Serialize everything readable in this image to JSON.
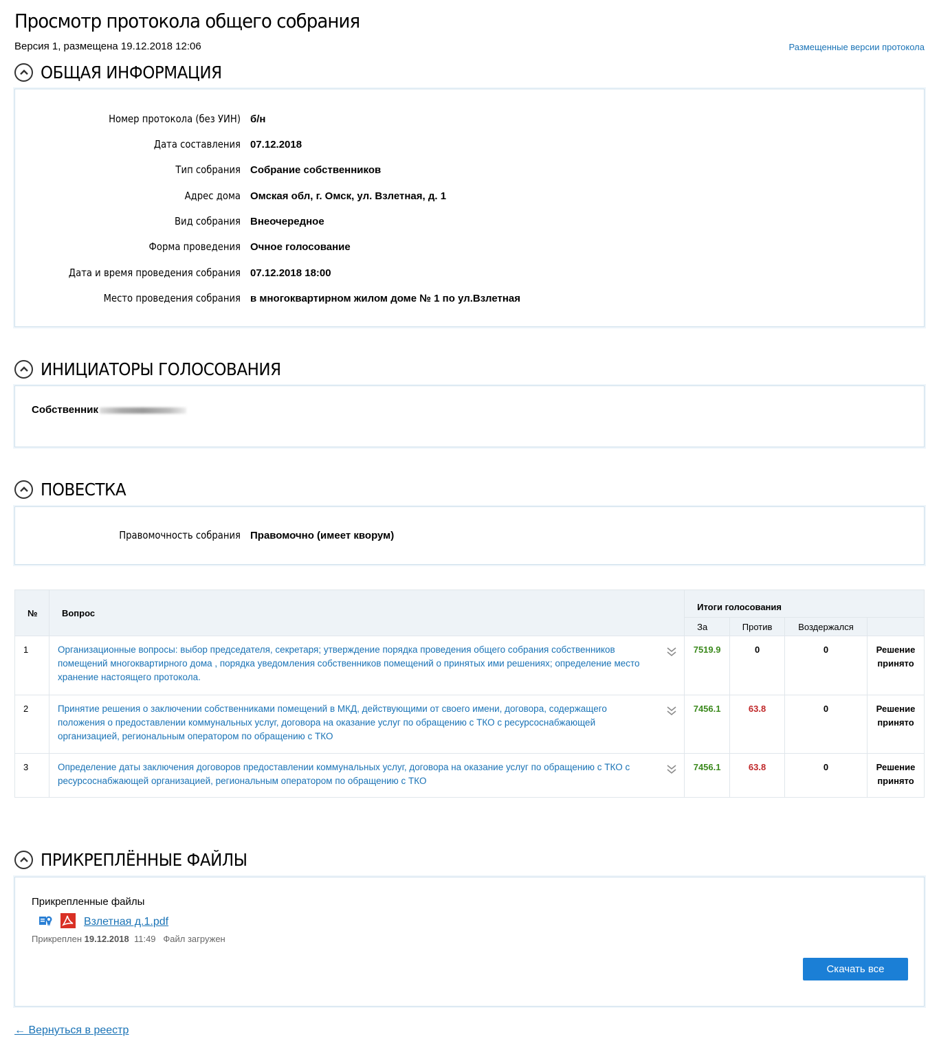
{
  "page": {
    "title": "Просмотр протокола общего собрания",
    "version": "Версия 1, размещена 19.12.2018 12:06",
    "versions_link": "Размещенные версии протокола"
  },
  "general": {
    "title": "ОБЩАЯ ИНФОРМАЦИЯ",
    "fields": [
      {
        "label": "Номер протокола (без УИН)",
        "value": "б/н"
      },
      {
        "label": "Дата составления",
        "value": "07.12.2018"
      },
      {
        "label": "Тип собрания",
        "value": "Собрание собственников"
      },
      {
        "label": "Адрес дома",
        "value": "Омская обл, г. Омск, ул. Взлетная, д. 1"
      },
      {
        "label": "Вид собрания",
        "value": "Внеочередное"
      },
      {
        "label": "Форма проведения",
        "value": "Очное голосование"
      },
      {
        "label": "Дата и время проведения собрания",
        "value": "07.12.2018 18:00"
      },
      {
        "label": "Место проведения собрания",
        "value": "в многоквартирном жилом доме № 1 по ул.Взлетная"
      }
    ]
  },
  "initiators": {
    "title": "ИНИЦИАТОРЫ ГОЛОСОВАНИЯ",
    "item": "Собственник"
  },
  "agenda": {
    "title": "ПОВЕСТКА",
    "quorum_label": "Правомочность собрания",
    "quorum_value": "Правомочно (имеет кворум)"
  },
  "votes": {
    "headers": {
      "num": "№",
      "question": "Вопрос",
      "results": "Итоги голосования",
      "za": "За",
      "protiv": "Против",
      "vozd": "Воздержался"
    },
    "rows": [
      {
        "num": "1",
        "question": "Организационные вопросы: выбор председателя, секретаря; утверждение порядка проведения общего собрания собственников помещений многоквартирного дома , порядка уведомления собственников помещений о принятых ими решениях; определение место хранение настоящего протокола.",
        "za": "7519.9",
        "protiv": "0",
        "vozd": "0",
        "result": "Решение принято"
      },
      {
        "num": "2",
        "question": "Принятие решения о заключении собственниками помещений в МКД, действующими от своего имени, договора, содержащего положения о предоставлении коммунальных услуг, договора на оказание услуг по обращению с ТКО с ресурсоснабжающей организацией, региональным оператором по обращению с ТКО",
        "za": "7456.1",
        "protiv": "63.8",
        "vozd": "0",
        "result": "Решение принято"
      },
      {
        "num": "3",
        "question": "Определение даты заключения договоров  предоставлении коммунальных услуг, договора на оказание услуг по обращению с ТКО с ресурсоснабжающей организацией, региональным оператором по обращению с ТКО",
        "za": "7456.1",
        "protiv": "63.8",
        "vozd": "0",
        "result": "Решение принято"
      }
    ]
  },
  "files": {
    "title": "ПРИКРЕПЛЁННЫЕ ФАЙЛЫ",
    "label": "Прикрепленные файлы",
    "file_name": "Взлетная д.1.pdf",
    "attached_prefix": "Прикреплен",
    "attached_date": "19.12.2018",
    "attached_time": "11:49",
    "status": "Файл загружен",
    "download_all": "Скачать все"
  },
  "back_link": "Вернуться в реестр",
  "back_arrow": "←"
}
